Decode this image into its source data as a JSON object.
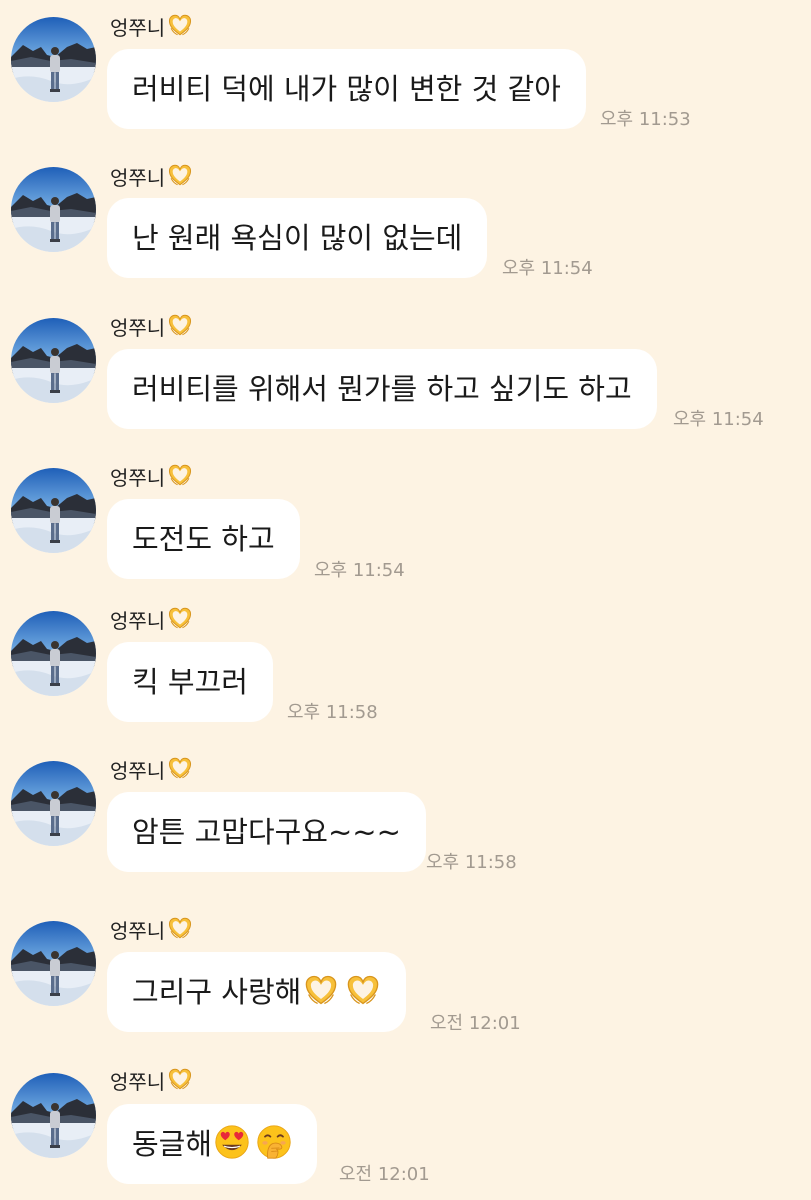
{
  "chat": {
    "sender_name": "엉쭈니",
    "messages": [
      {
        "text": "러비티 덕에 내가 많이 변한 것 같아",
        "time": "오후 11:53"
      },
      {
        "text": "난 원래 욕심이 많이 없는데",
        "time": "오후 11:54"
      },
      {
        "text": "러비티를 위해서 뭔가를 하고 싶기도 하고",
        "time": "오후 11:54"
      },
      {
        "text": "도전도 하고",
        "time": "오후 11:54"
      },
      {
        "text": "킥 부끄러",
        "time": "오후 11:58"
      },
      {
        "text": "암튼 고맙다구요~~~",
        "time": "오후 11:58"
      },
      {
        "text": "그리구 사랑해",
        "time": "오전 12:01"
      },
      {
        "text": "동글해",
        "time": "오전 12:01"
      }
    ]
  },
  "icons": {
    "name_emoji": "heart-hands-icon",
    "message_7_emojis": [
      "heart-hands-icon",
      "heart-hands-icon"
    ],
    "message_8_emojis": [
      "heart-eyes-face-icon",
      "face-with-hand-over-mouth-icon"
    ]
  },
  "colors": {
    "background": "#fdf3e3",
    "bubble": "#ffffff",
    "timestamp": "#a29a90"
  }
}
